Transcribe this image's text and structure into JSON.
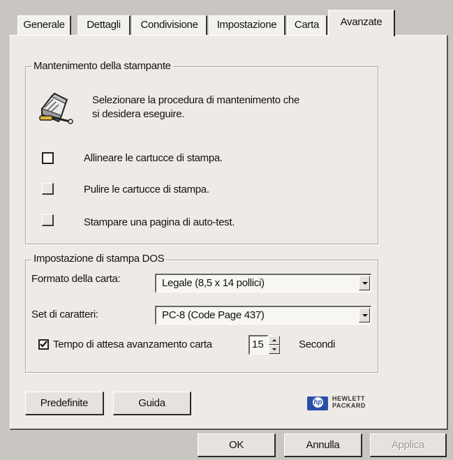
{
  "tabs": [
    {
      "label": "Generale"
    },
    {
      "label": "Dettagli"
    },
    {
      "label": "Condivisione"
    },
    {
      "label": "Impostazione"
    },
    {
      "label": "Carta"
    },
    {
      "label": "Avanzate"
    }
  ],
  "maintenance": {
    "legend": "Mantenimento della stampante",
    "icon": "printer-wrench-icon",
    "description_line1": "Selezionare la procedura di mantenimento che",
    "description_line2": "si desidera eseguire.",
    "actions": [
      {
        "label": "Allineare le cartucce di stampa."
      },
      {
        "label": "Pulire le cartucce di stampa."
      },
      {
        "label": "Stampare una pagina di auto-test."
      }
    ]
  },
  "dos": {
    "legend": "Impostazione di stampa DOS",
    "paper_format_label": "Formato della carta:",
    "paper_format_value": "Legale (8,5 x 14 pollici)",
    "charset_label": "Set di caratteri:",
    "charset_value": "PC-8 (Code Page 437)",
    "wait_checkbox_checked": true,
    "wait_label": "Tempo di attesa avanzamento carta",
    "wait_value": "15",
    "wait_unit": "Secondi"
  },
  "buttons": {
    "defaults": "Predefinite",
    "help": "Guida",
    "ok": "OK",
    "cancel": "Annulla",
    "apply": "Applica"
  },
  "logo": {
    "line1": "HEWLETT",
    "line2": "PACKARD",
    "mark": "hp"
  }
}
